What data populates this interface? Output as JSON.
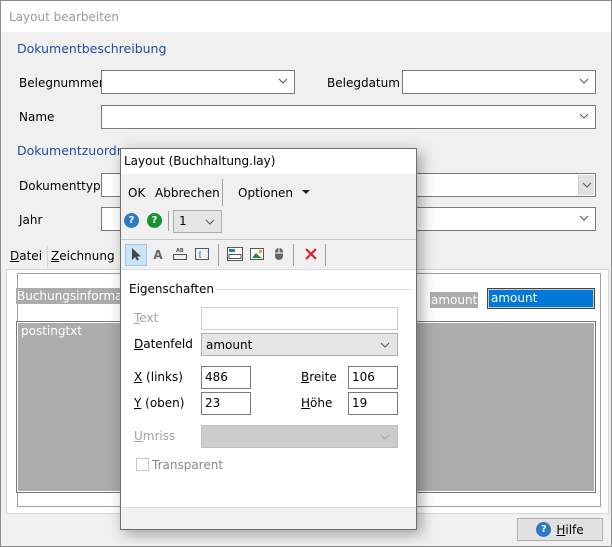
{
  "main_window": {
    "title": "Layout bearbeiten",
    "section_description": "Dokumentbeschreibung",
    "section_assignment": "Dokumentzuordnung",
    "fields": {
      "belegnummer": {
        "label": "Belegnummer",
        "value": ""
      },
      "belegdatum": {
        "label": "Belegdatum",
        "value": ""
      },
      "name": {
        "label": "Name",
        "value": ""
      },
      "dokumenttyp": {
        "label": "Dokumenttyp",
        "value": ""
      },
      "jahr": {
        "label": "Jahr",
        "value": ""
      }
    },
    "tabs": [
      {
        "label": "Datei",
        "mnemonic": "D",
        "rest": "atei"
      },
      {
        "label": "Zeichnung",
        "mnemonic": "Z",
        "rest": "eichnung"
      }
    ],
    "canvas": {
      "header_label": "Buchungsinformation",
      "amount_label": "amount",
      "amount_field_selected": "amount",
      "posting_box_label": "postingtxt"
    },
    "help_button": {
      "label": "Hilfe",
      "mnemonic": "H",
      "rest": "ilfe",
      "icon": "question-icon"
    }
  },
  "layout_dialog": {
    "title": "Layout (Buchhaltung.lay)",
    "ok_label": "OK",
    "cancel_label": "Abbrechen",
    "options_label": "Optionen",
    "help_icons": [
      "help-blue-question-icon",
      "help-green-question-icon"
    ],
    "page_select_value": "1",
    "tools": [
      "pointer-icon",
      "text-icon",
      "field-icon",
      "bracket-field-icon",
      "frame-icon",
      "image-icon",
      "mouse-icon",
      "delete-icon"
    ],
    "properties": {
      "legend": "Eigenschaften",
      "text": {
        "label": "Text",
        "mnemonic": "T",
        "rest": "ext",
        "value": "",
        "disabled": true
      },
      "datenfeld": {
        "label": "Datenfeld",
        "mnemonic": "D",
        "rest": "atenfeld",
        "value": "amount"
      },
      "x": {
        "label": "X (links)",
        "mnemonic": "X",
        "rest": " (links)",
        "value": "486"
      },
      "y": {
        "label": "Y (oben)",
        "mnemonic": "Y",
        "rest": " (oben)",
        "value": "23"
      },
      "breite": {
        "label": "Breite",
        "mnemonic": "B",
        "rest": "reite",
        "value": "106"
      },
      "hoehe": {
        "label": "Höhe",
        "mnemonic": "H",
        "rest": "öhe",
        "value": "19"
      },
      "umriss": {
        "label": "Umriss",
        "mnemonic": "U",
        "rest": "mriss",
        "value": "",
        "disabled": true
      },
      "transparent": {
        "label": "Transparent",
        "checked": false,
        "disabled": true
      }
    }
  },
  "colors": {
    "section_title": "#1f4ea3",
    "selection": "#0078d7",
    "canvas_gray": "#acacac",
    "help_blue": "#2d7bc4",
    "help_green": "#12952f",
    "delete_red": "#d9262c"
  }
}
